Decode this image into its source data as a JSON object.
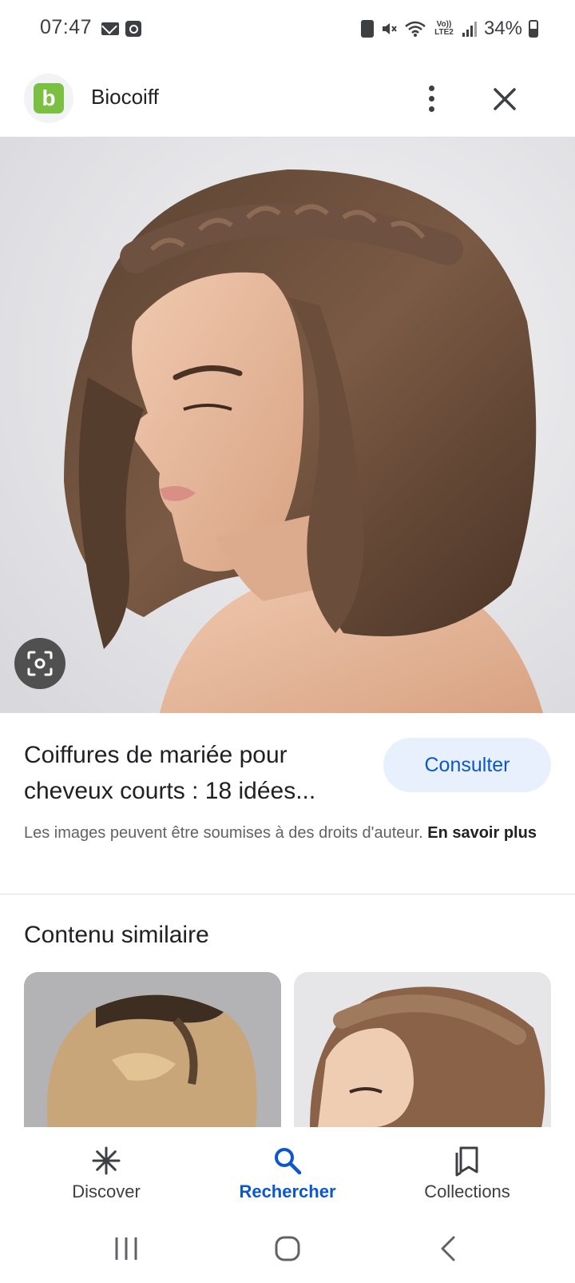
{
  "status_bar": {
    "time": "07:47",
    "network": "Vo)) LTE2",
    "battery_percent": "34%"
  },
  "header": {
    "site_name": "Biocoiff",
    "logo_letter": "b"
  },
  "result": {
    "title": "Coiffures de mariée pour cheveux courts : 18 idées...",
    "consult_label": "Consulter",
    "copyright_text": "Les images peuvent être soumises à des droits d'auteur.",
    "learn_more_label": "En savoir plus"
  },
  "similar": {
    "title": "Contenu similaire"
  },
  "bottom_nav": {
    "items": [
      {
        "label": "Discover",
        "icon": "asterisk-icon"
      },
      {
        "label": "Rechercher",
        "icon": "search-icon",
        "active": true
      },
      {
        "label": "Collections",
        "icon": "collections-icon"
      }
    ]
  },
  "colors": {
    "accent": "#0b57d0",
    "consult_bg": "#e8f0fe",
    "logo_green": "#7bc043"
  }
}
